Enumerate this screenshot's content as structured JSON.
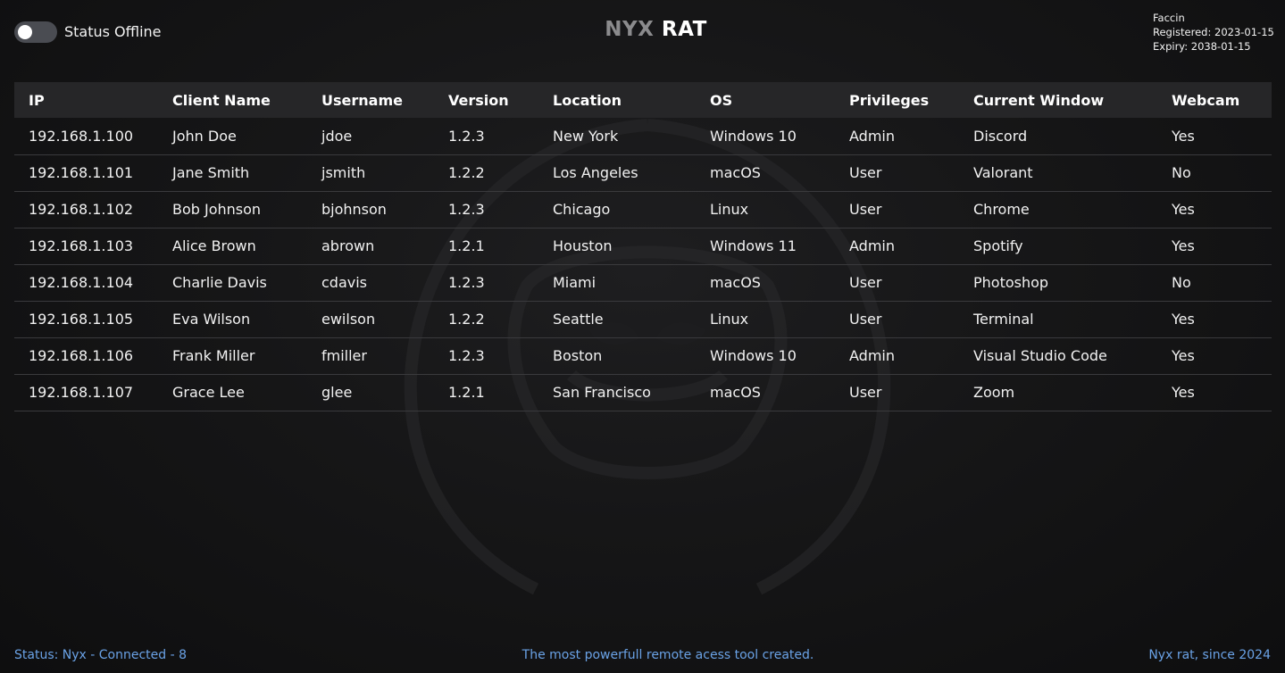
{
  "header": {
    "status_label": "Status",
    "status_value": "Offline",
    "toggle_on": false,
    "brand_part1": "NYX",
    "brand_part2": "RAT",
    "user_name": "Faccin",
    "registered": "Registered: 2023-01-15",
    "expiry": "Expiry: 2038-01-15"
  },
  "table": {
    "columns": [
      "IP",
      "Client Name",
      "Username",
      "Version",
      "Location",
      "OS",
      "Privileges",
      "Current Window",
      "Webcam"
    ],
    "rows": [
      [
        "192.168.1.100",
        "John Doe",
        "jdoe",
        "1.2.3",
        "New York",
        "Windows 10",
        "Admin",
        "Discord",
        "Yes"
      ],
      [
        "192.168.1.101",
        "Jane Smith",
        "jsmith",
        "1.2.2",
        "Los Angeles",
        "macOS",
        "User",
        "Valorant",
        "No"
      ],
      [
        "192.168.1.102",
        "Bob Johnson",
        "bjohnson",
        "1.2.3",
        "Chicago",
        "Linux",
        "User",
        "Chrome",
        "Yes"
      ],
      [
        "192.168.1.103",
        "Alice Brown",
        "abrown",
        "1.2.1",
        "Houston",
        "Windows 11",
        "Admin",
        "Spotify",
        "Yes"
      ],
      [
        "192.168.1.104",
        "Charlie Davis",
        "cdavis",
        "1.2.3",
        "Miami",
        "macOS",
        "User",
        "Photoshop",
        "No"
      ],
      [
        "192.168.1.105",
        "Eva Wilson",
        "ewilson",
        "1.2.2",
        "Seattle",
        "Linux",
        "User",
        "Terminal",
        "Yes"
      ],
      [
        "192.168.1.106",
        "Frank Miller",
        "fmiller",
        "1.2.3",
        "Boston",
        "Windows 10",
        "Admin",
        "Visual Studio Code",
        "Yes"
      ],
      [
        "192.168.1.107",
        "Grace Lee",
        "glee",
        "1.2.1",
        "San Francisco",
        "macOS",
        "User",
        "Zoom",
        "Yes"
      ]
    ]
  },
  "footer": {
    "left": "Status: Nyx - Connected - 8",
    "center": "The most powerfull remote acess tool created.",
    "right": "Nyx rat, since 2024"
  },
  "colors": {
    "background": "#121213",
    "header_row": "#262628",
    "row_divider": "#3a3a3d",
    "footer_text": "#6aa2e6",
    "brand_gray": "#8b8b8d"
  },
  "icons": {
    "watermark": "hooded-figure-logo"
  }
}
